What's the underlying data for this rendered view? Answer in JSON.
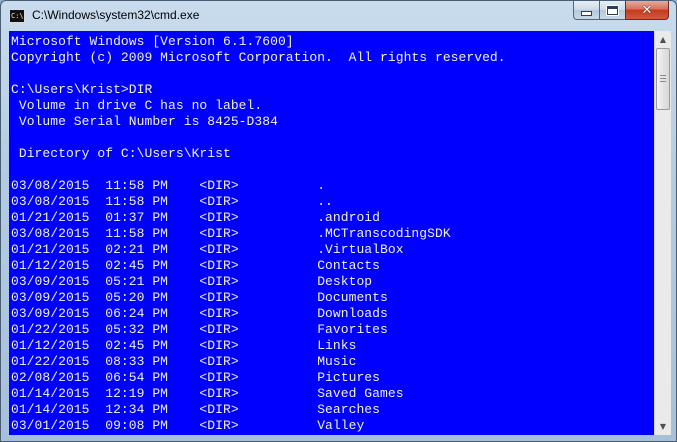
{
  "window": {
    "title": "C:\\Windows\\system32\\cmd.exe",
    "icon": "cmd-icon",
    "icon_glyph": "C:\\"
  },
  "caption_buttons": {
    "minimize": "minimize-icon",
    "maximize": "maximize-icon",
    "close": "close-icon",
    "close_glyph": "✕"
  },
  "colors": {
    "console_background": "#0000FF",
    "console_text": "#F0F0F0"
  },
  "console": {
    "lines": [
      "Microsoft Windows [Version 6.1.7600]",
      "Copyright (c) 2009 Microsoft Corporation.  All rights reserved.",
      "",
      "C:\\Users\\Krist>DIR",
      " Volume in drive C has no label.",
      " Volume Serial Number is 8425-D384",
      "",
      " Directory of C:\\Users\\Krist",
      "",
      "03/08/2015  11:58 PM    <DIR>          .",
      "03/08/2015  11:58 PM    <DIR>          ..",
      "01/21/2015  01:37 PM    <DIR>          .android",
      "03/08/2015  11:58 PM    <DIR>          .MCTranscodingSDK",
      "01/21/2015  02:21 PM    <DIR>          .VirtualBox",
      "01/12/2015  02:45 PM    <DIR>          Contacts",
      "03/09/2015  05:21 PM    <DIR>          Desktop",
      "03/09/2015  05:20 PM    <DIR>          Documents",
      "03/09/2015  06:24 PM    <DIR>          Downloads",
      "01/22/2015  05:32 PM    <DIR>          Favorites",
      "01/12/2015  02:45 PM    <DIR>          Links",
      "01/22/2015  08:33 PM    <DIR>          Music",
      "02/08/2015  06:54 PM    <DIR>          Pictures",
      "01/14/2015  12:19 PM    <DIR>          Saved Games",
      "01/14/2015  12:34 PM    <DIR>          Searches",
      "03/01/2015  09:08 PM    <DIR>          Valley"
    ]
  },
  "scrollbar": {
    "up_arrow": "▲",
    "down_arrow": "▼"
  }
}
